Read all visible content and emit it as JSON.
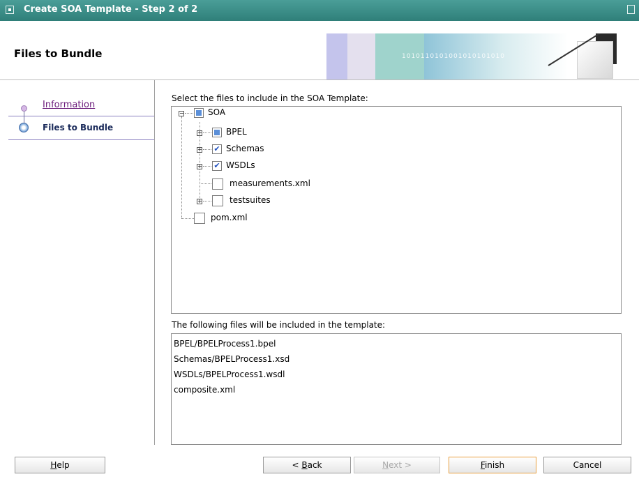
{
  "window": {
    "title": "Create SOA Template - Step 2 of 2"
  },
  "header": {
    "heading": "Files to Bundle",
    "banner_digits": "1010110101001010101010"
  },
  "nav": {
    "items": [
      {
        "label": "Information"
      },
      {
        "label": "Files to Bundle"
      }
    ]
  },
  "select_label": "Select the files to include in the SOA Template:",
  "tree": {
    "nodes": [
      {
        "label": "SOA",
        "state": "partial",
        "expander": "minus"
      },
      {
        "label": "BPEL",
        "state": "partial",
        "expander": "plus"
      },
      {
        "label": "Schemas",
        "state": "checked",
        "expander": "plus"
      },
      {
        "label": "WSDLs",
        "state": "checked",
        "expander": "plus"
      },
      {
        "label": "measurements.xml",
        "state": "unchecked",
        "expander": "none"
      },
      {
        "label": "testsuites",
        "state": "unchecked",
        "expander": "plus"
      },
      {
        "label": "pom.xml",
        "state": "unchecked",
        "expander": "none"
      }
    ]
  },
  "files_label": "The following files will be included in the template:",
  "files": [
    "BPEL/BPELProcess1.bpel",
    "Schemas/BPELProcess1.xsd",
    "WSDLs/BPELProcess1.wsdl",
    "composite.xml"
  ],
  "buttons": {
    "help": {
      "u": "H",
      "rest": "elp"
    },
    "back": {
      "pre": "< ",
      "u": "B",
      "rest": "ack"
    },
    "next": {
      "u": "N",
      "rest": "ext >"
    },
    "finish": {
      "u": "F",
      "rest": "inish"
    },
    "cancel": {
      "label": "Cancel"
    }
  },
  "colors": {
    "titlebar": "#3b8f89",
    "accent_border": "#e8a040",
    "check": "#2050c0"
  }
}
